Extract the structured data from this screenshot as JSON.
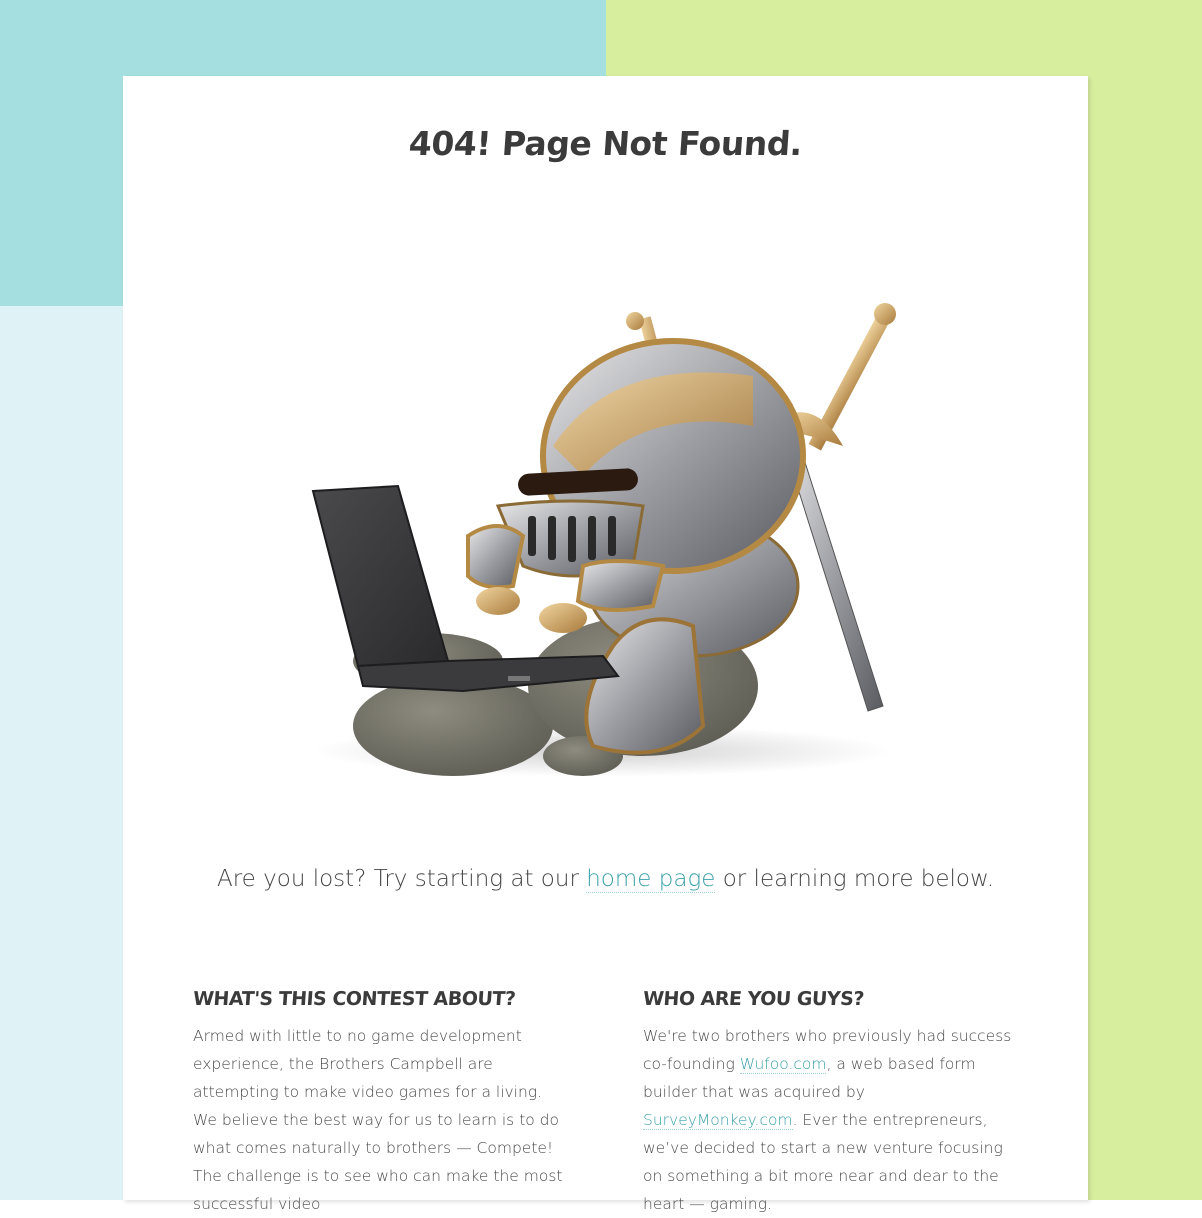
{
  "page": {
    "title": "404! Page Not Found.",
    "tagline_before": "Are you lost? Try starting at our",
    "tagline_link": "home page",
    "tagline_after": "or learning more below."
  },
  "colors": {
    "bg_teal": "#a6dfdf",
    "bg_green": "#d8ee9f",
    "bg_lightblue": "#dff3f6",
    "link": "#3aa0a8",
    "heading": "#3b3b3b"
  },
  "illustration": {
    "subject": "armored knight with sword typing on a laptop while sitting on stones"
  },
  "sections": {
    "contest": {
      "heading": "WHAT'S THIS CONTEST ABOUT?",
      "body": "Armed with little to no game development experience, the Brothers Campbell are attempting to make video games for a living. We believe the best way for us to learn is to do what comes naturally to brothers — Compete! The challenge is to see who can make the most successful video"
    },
    "about": {
      "heading": "WHO ARE YOU GUYS?",
      "body_1": "We're two brothers who previously had success co-founding",
      "link_1": "Wufoo.com",
      "body_2": ", a web based form builder that was acquired by",
      "link_2": "SurveyMonkey.com",
      "body_3": ". Ever the entrepreneurs, we’ve decided to start a new venture focusing on something a bit more near and dear to the heart — gaming."
    }
  }
}
